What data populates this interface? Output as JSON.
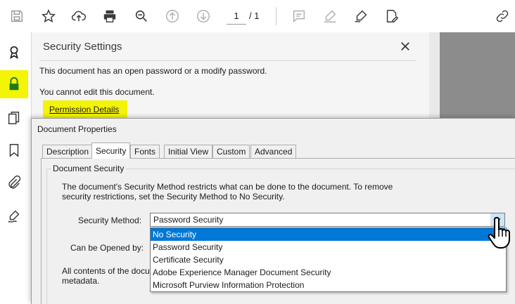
{
  "toolbar": {
    "page_current": "1",
    "page_total": "/ 1",
    "icons": [
      "save-icon",
      "star-icon",
      "upload-cloud-icon",
      "print-icon",
      "zoom-icon",
      "page-up-icon",
      "page-down-icon",
      "comment-icon",
      "highlight-icon",
      "sign-icon",
      "edit-pdf-icon",
      "share-link-icon"
    ]
  },
  "rail": {
    "icons": [
      "certificate-icon",
      "lock-icon",
      "pages-icon",
      "bookmark-icon",
      "attachment-icon",
      "signature-icon"
    ],
    "highlight_color": "#f4f406"
  },
  "panel": {
    "title": "Security Settings",
    "message1": "This document has an open password or a modify password.",
    "message2": "You cannot edit this document.",
    "link": "Permission Details"
  },
  "dialog": {
    "title": "Document Properties",
    "tabs": [
      "Description",
      "Security",
      "Fonts",
      "Initial View",
      "Custom",
      "Advanced"
    ],
    "active_tab": "Security",
    "group_title": "Document Security",
    "description": "The document's Security Method restricts what can be done to the document. To remove security restrictions, set the Security Method to No Security.",
    "method_label": "Security Method:",
    "opened_label": "Can be Opened by:",
    "all_contents": "All contents of the docu",
    "metadata": "metadata.",
    "method_value": "Password Security",
    "options": [
      "No Security",
      "Password Security",
      "Certificate Security",
      "Adobe Experience Manager Document Security",
      "Microsoft Purview Information Protection"
    ],
    "selected_option": "No Security"
  },
  "colors": {
    "selection": "#0078d7",
    "highlight": "#f4f406",
    "lock": "#1d7a1d"
  }
}
